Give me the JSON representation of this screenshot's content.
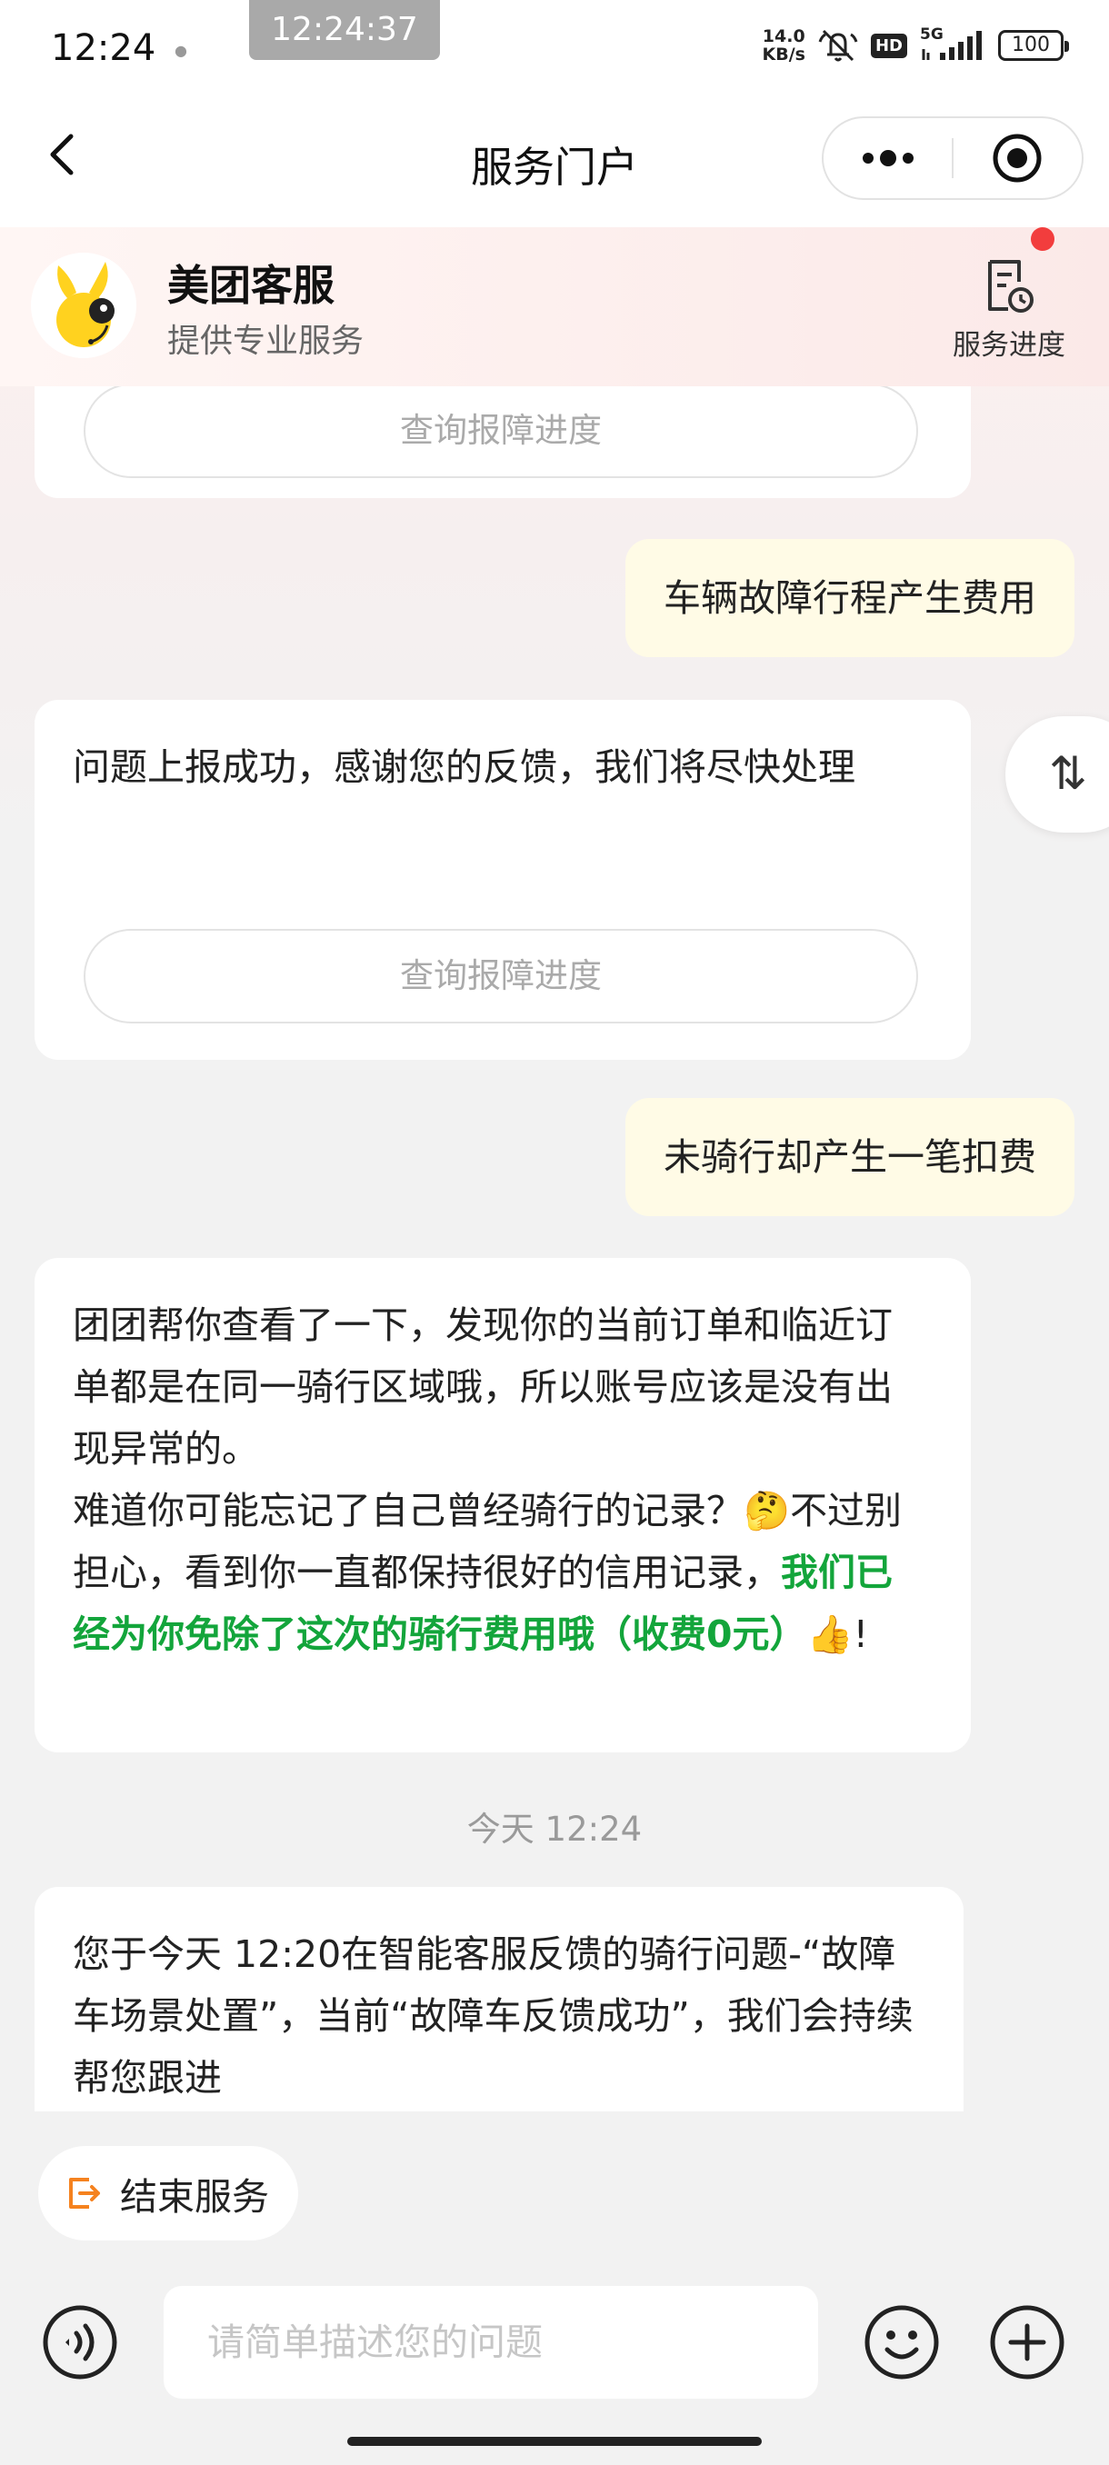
{
  "status_bar": {
    "time": "12:24",
    "screenshot_time": "12:24:37",
    "net_speed": "14.0",
    "net_unit": "KB/s",
    "hd": "HD",
    "signal": "5G",
    "battery": "100"
  },
  "nav": {
    "title": "服务门户"
  },
  "agent": {
    "name": "美团客服",
    "subtitle": "提供专业服务",
    "progress_label": "服务进度"
  },
  "messages": {
    "top_partial_button": "查询报障进度",
    "user_msg_1": "车辆故障行程产生费用",
    "bot_msg_1": "问题上报成功，感谢您的反馈，我们将尽快处理",
    "bot_msg_1_button": "查询报障进度",
    "user_msg_2": "未骑行却产生一笔扣费",
    "bot_msg_2_p1": "团团帮你查看了一下，发现你的当前订单和临近订单都是在同一骑行区域哦，所以账号应该是没有出现异常的。",
    "bot_msg_2_p2a": "难道你可能忘记了自己曾经骑行的记录？",
    "bot_msg_2_emoji1": "🤔",
    "bot_msg_2_p2b": "不过别担心，看到你一直都保持很好的信用记录，",
    "bot_msg_2_green": "我们已经为你免除了这次的骑行费用哦（收费0元）",
    "bot_msg_2_emoji2": "👍",
    "bot_msg_2_end": "!",
    "timestamp": "今天 12:24",
    "bot_msg_3": "您于今天 12:20在智能客服反馈的骑行问题-“故障车场景处置”，当前“故障车反馈成功”，我们会持续帮您跟进"
  },
  "bottom": {
    "end_service": "结束服务",
    "input_placeholder": "请简单描述您的问题"
  },
  "colors": {
    "accent_green": "#13a53b",
    "user_bubble": "#fffbe6",
    "badge_red": "#f23d3d",
    "end_icon_orange": "#f5821f"
  }
}
